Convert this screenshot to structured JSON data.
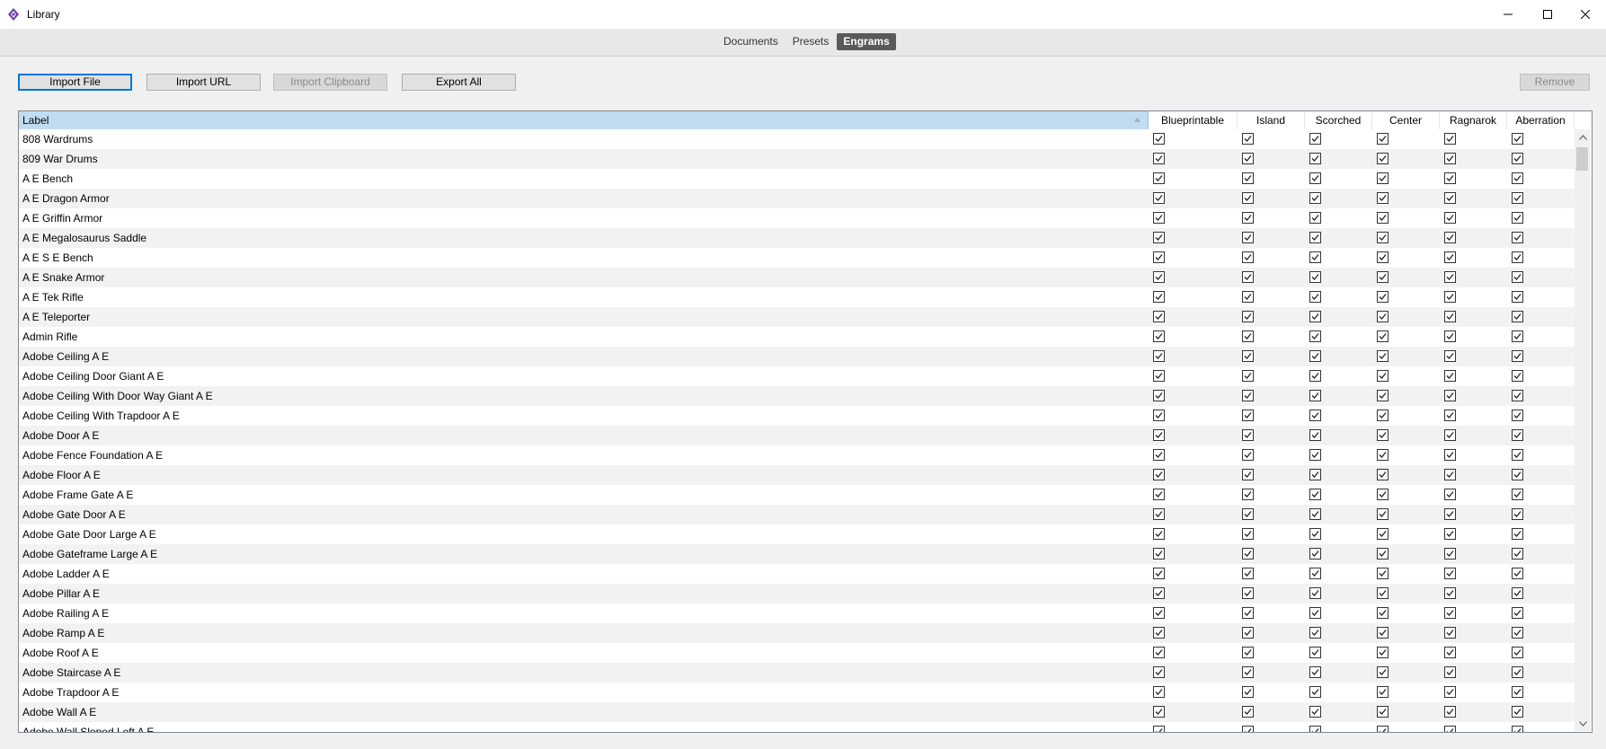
{
  "window": {
    "title": "Library"
  },
  "tabs": [
    {
      "label": "Documents",
      "active": false
    },
    {
      "label": "Presets",
      "active": false
    },
    {
      "label": "Engrams",
      "active": true
    }
  ],
  "toolbar": {
    "import_file": "Import File",
    "import_url": "Import URL",
    "import_clipboard": "Import Clipboard",
    "export_all": "Export All",
    "remove": "Remove"
  },
  "table": {
    "columns": [
      "Label",
      "Blueprintable",
      "Island",
      "Scorched",
      "Center",
      "Ragnarok",
      "Aberration"
    ],
    "rows": [
      "808 Wardrums",
      "809 War Drums",
      "A E Bench",
      "A E Dragon Armor",
      "A E Griffin Armor",
      "A E Megalosaurus Saddle",
      "A E S E Bench",
      "A E Snake Armor",
      "A E Tek Rifle",
      "A E Teleporter",
      "Admin Rifle",
      "Adobe Ceiling A E",
      "Adobe Ceiling Door Giant A E",
      "Adobe Ceiling With Door Way Giant A E",
      "Adobe Ceiling With Trapdoor A E",
      "Adobe Door A E",
      "Adobe Fence Foundation A E",
      "Adobe Floor A E",
      "Adobe Frame Gate A E",
      "Adobe Gate Door A E",
      "Adobe Gate Door Large A E",
      "Adobe Gateframe Large A E",
      "Adobe Ladder A E",
      "Adobe Pillar A E",
      "Adobe Railing A E",
      "Adobe Ramp A E",
      "Adobe Roof A E",
      "Adobe Staircase A E",
      "Adobe Trapdoor A E",
      "Adobe Wall A E",
      "Adobe Wall Sloped Left A E"
    ],
    "all_checked": true
  }
}
